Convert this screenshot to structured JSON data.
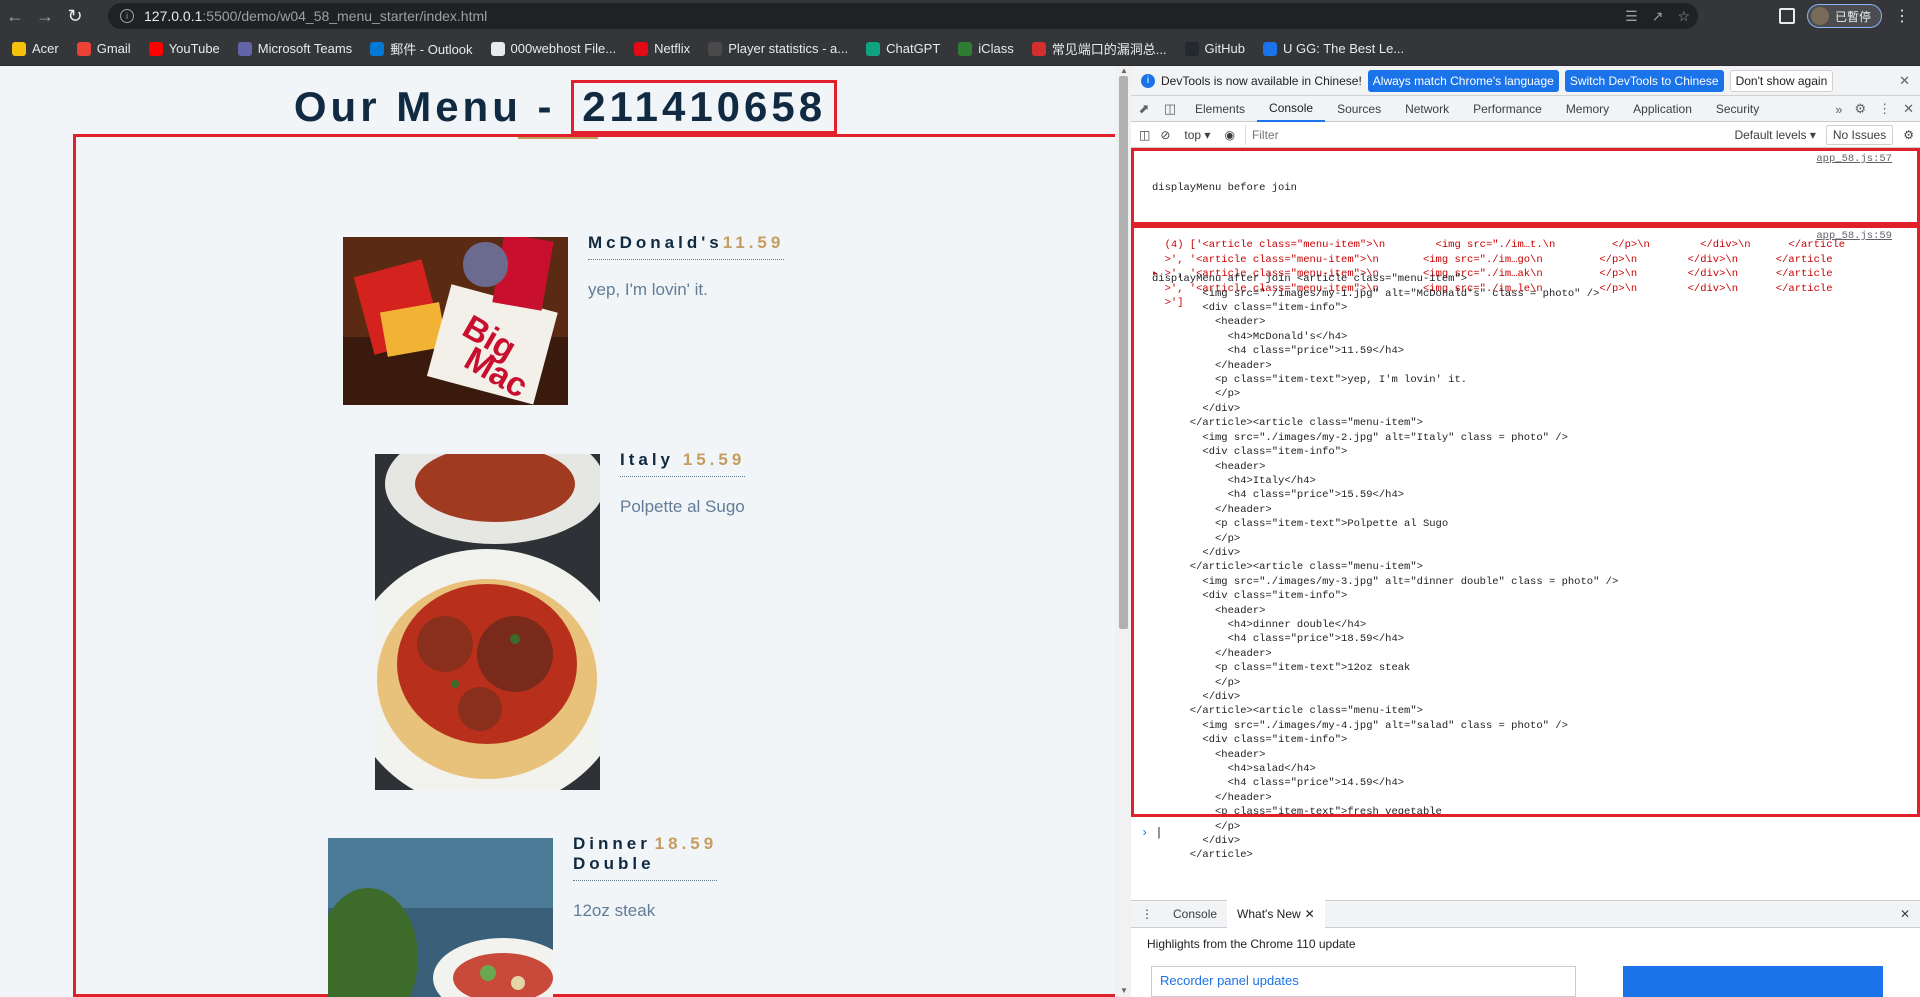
{
  "browser": {
    "url_host": "127.0.0.1",
    "url_path": ":5500/demo/w04_58_menu_starter/index.html",
    "profile_label": "已暫停",
    "bookmarks": [
      {
        "label": "Acer",
        "color": "#f4c20d"
      },
      {
        "label": "Gmail",
        "color": "#ea4335"
      },
      {
        "label": "YouTube",
        "color": "#ff0000"
      },
      {
        "label": "Microsoft Teams",
        "color": "#6264a7"
      },
      {
        "label": "郵件 - Outlook",
        "color": "#0078d4"
      },
      {
        "label": "000webhost File...",
        "color": "#e8eaed"
      },
      {
        "label": "Netflix",
        "color": "#e50914"
      },
      {
        "label": "Player statistics - a...",
        "color": "#4a4a4a"
      },
      {
        "label": "ChatGPT",
        "color": "#10a37f"
      },
      {
        "label": "iClass",
        "color": "#2e7d32"
      },
      {
        "label": "常见端口的漏洞总...",
        "color": "#d32f2f"
      },
      {
        "label": "GitHub",
        "color": "#24292e"
      },
      {
        "label": "U GG: The Best Le...",
        "color": "#1a73e8"
      }
    ]
  },
  "page": {
    "title_prefix": "Our Menu - ",
    "title_id": "211410658",
    "accent": "#c59d5f",
    "items": [
      {
        "name": "McDonald's",
        "price": "11.59",
        "text": "yep, I'm lovin' it.",
        "alt": "McDonald's"
      },
      {
        "name": "Italy",
        "price": " 15.59",
        "text": "Polpette al Sugo",
        "alt": "Italy"
      },
      {
        "name": "Dinner Double",
        "price": "18.59",
        "text": "12oz steak",
        "alt": "dinner double"
      }
    ]
  },
  "devtools": {
    "infobar": {
      "message": "DevTools is now available in Chinese!",
      "btn_match": "Always match Chrome's language",
      "btn_switch": "Switch DevTools to Chinese",
      "btn_dismiss": "Don't show again"
    },
    "tabs": [
      "Elements",
      "Console",
      "Sources",
      "Network",
      "Performance",
      "Memory",
      "Application",
      "Security"
    ],
    "active_tab": "Console",
    "context": "top",
    "filter_placeholder": "Filter",
    "levels": "Default levels",
    "issues": "No Issues",
    "msg1": {
      "label": "displayMenu before join",
      "source": "app_58.js:57",
      "lines": [
        "  (4) ['<article class=\"menu-item\">\\n        <img src=\"./im…t.\\n         </p>\\n        </div>\\n      </article",
        "  >', '<article class=\"menu-item\">\\n       <img src=\"./im…go\\n         </p>\\n        </div>\\n      </article",
        "▸ >', '<article class=\"menu-item\">\\n       <img src=\"./im…ak\\n         </p>\\n        </div>\\n      </article",
        "  >', '<article class=\"menu-item\">\\n       <img src=\"./im…le\\n         </p>\\n        </div>\\n      </article",
        "  >']"
      ]
    },
    "msg2": {
      "source": "app_58.js:59",
      "lines": [
        "displayMenu after join <article class=\"menu-item\">",
        "        <img src=\"./images/my-1.jpg\" alt=\"McDonald's\" class = photo\" />",
        "        <div class=\"item-info\">",
        "          <header>",
        "            <h4>McDonald's</h4>",
        "            <h4 class=\"price\">11.59</h4>",
        "          </header>",
        "          <p class=\"item-text\">yep, I'm lovin' it.",
        "          </p>",
        "        </div>",
        "      </article><article class=\"menu-item\">",
        "        <img src=\"./images/my-2.jpg\" alt=\"Italy\" class = photo\" />",
        "        <div class=\"item-info\">",
        "          <header>",
        "            <h4>Italy</h4>",
        "            <h4 class=\"price\">15.59</h4>",
        "          </header>",
        "          <p class=\"item-text\">Polpette al Sugo",
        "          </p>",
        "        </div>",
        "      </article><article class=\"menu-item\">",
        "        <img src=\"./images/my-3.jpg\" alt=\"dinner double\" class = photo\" />",
        "        <div class=\"item-info\">",
        "          <header>",
        "            <h4>dinner double</h4>",
        "            <h4 class=\"price\">18.59</h4>",
        "          </header>",
        "          <p class=\"item-text\">12oz steak",
        "          </p>",
        "        </div>",
        "      </article><article class=\"menu-item\">",
        "        <img src=\"./images/my-4.jpg\" alt=\"salad\" class = photo\" />",
        "        <div class=\"item-info\">",
        "          <header>",
        "            <h4>salad</h4>",
        "            <h4 class=\"price\">14.59</h4>",
        "          </header>",
        "          <p class=\"item-text\">fresh vegetable",
        "          </p>",
        "        </div>",
        "      </article>"
      ]
    },
    "drawer": {
      "tab_console": "Console",
      "tab_whatsnew": "What's New",
      "highlights": "Highlights from the Chrome 110 update",
      "card_title": "Recorder panel updates"
    }
  }
}
